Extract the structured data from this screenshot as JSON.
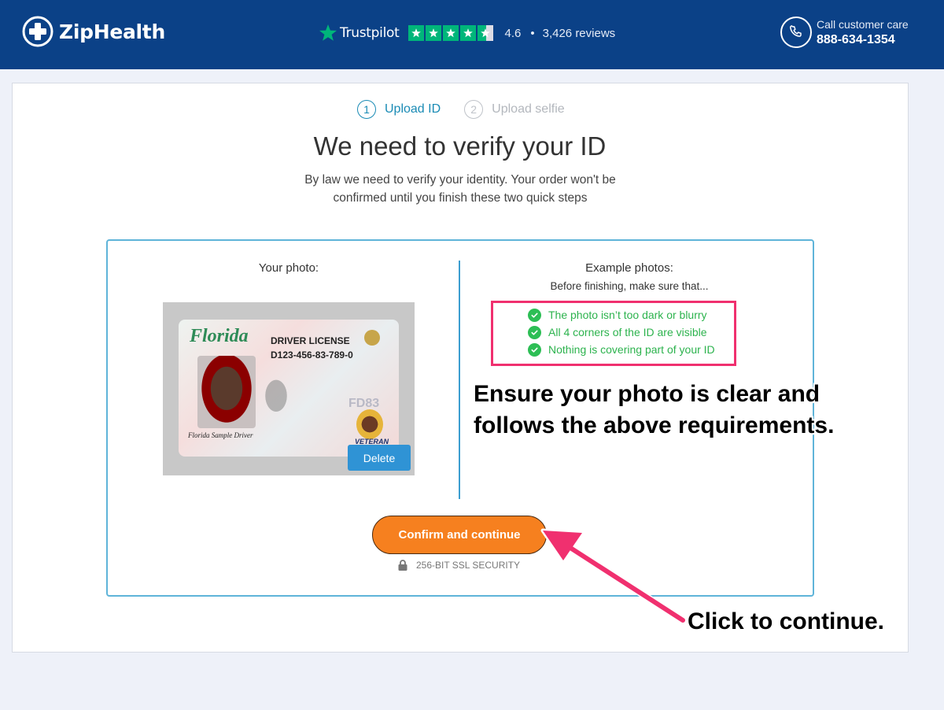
{
  "header": {
    "brand": "ZipHealth",
    "trustpilot": {
      "name": "Trustpilot",
      "rating": "4.6",
      "separator": "•",
      "reviews": "3,426 reviews",
      "stars": 4.5
    },
    "care_label": "Call customer care",
    "care_phone": "888-634-1354"
  },
  "steps": [
    {
      "num": "1",
      "label": "Upload ID",
      "active": true
    },
    {
      "num": "2",
      "label": "Upload selfie",
      "active": false
    }
  ],
  "main": {
    "title": "We need to verify your ID",
    "subtitle": "By law we need to verify your identity. Your order won't be confirmed until you finish these two quick steps"
  },
  "photo": {
    "label": "Your photo:",
    "delete_label": "Delete",
    "id_card": {
      "state": "Florida",
      "type": "DRIVER LICENSE",
      "number": "D123-456-83-789-0"
    }
  },
  "examples": {
    "label": "Example photos:",
    "subtitle": "Before finishing, make sure that...",
    "requirements": [
      "The photo isn’t too dark or blurry",
      "All 4 corners of the ID are visible",
      "Nothing is covering part of your ID"
    ]
  },
  "actions": {
    "confirm_label": "Confirm and continue",
    "ssl_label": "256-BIT SSL SECURITY"
  },
  "annotations": {
    "requirements_note_line1": "Ensure your photo is clear and",
    "requirements_note_line2": "follows the above requirements.",
    "continue_note": "Click to continue."
  },
  "colors": {
    "header_bg": "#0b4187",
    "accent": "#1a8bb5",
    "success": "#2db34e",
    "cta": "#f6801f",
    "highlight": "#f0306f",
    "trustpilot_green": "#00b67a"
  }
}
